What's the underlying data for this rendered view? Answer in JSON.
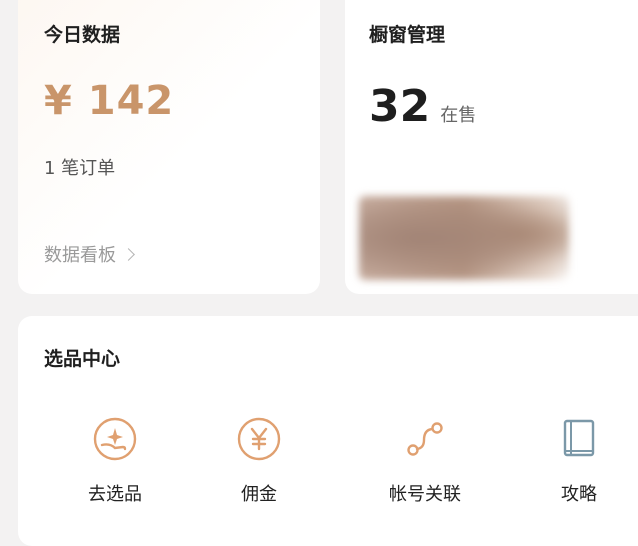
{
  "today": {
    "title": "今日数据",
    "amount": "¥ 142",
    "orders": "1 笔订单",
    "link_label": "数据看板"
  },
  "window": {
    "title": "橱窗管理",
    "count": "32",
    "count_unit": "在售"
  },
  "select_center": {
    "title": "选品中心",
    "items": [
      {
        "label": "去选品",
        "icon": "hand-sparkle-icon"
      },
      {
        "label": "佣金",
        "icon": "yen-circle-icon"
      },
      {
        "label": "帐号关联",
        "icon": "link-nodes-icon"
      },
      {
        "label": "攻略",
        "icon": "book-icon"
      }
    ]
  },
  "colors": {
    "accent": "#c9956a",
    "icon_orange": "#e0a070",
    "icon_book": "#7b98a8",
    "background": "#f3f2f2",
    "card": "#ffffff"
  }
}
